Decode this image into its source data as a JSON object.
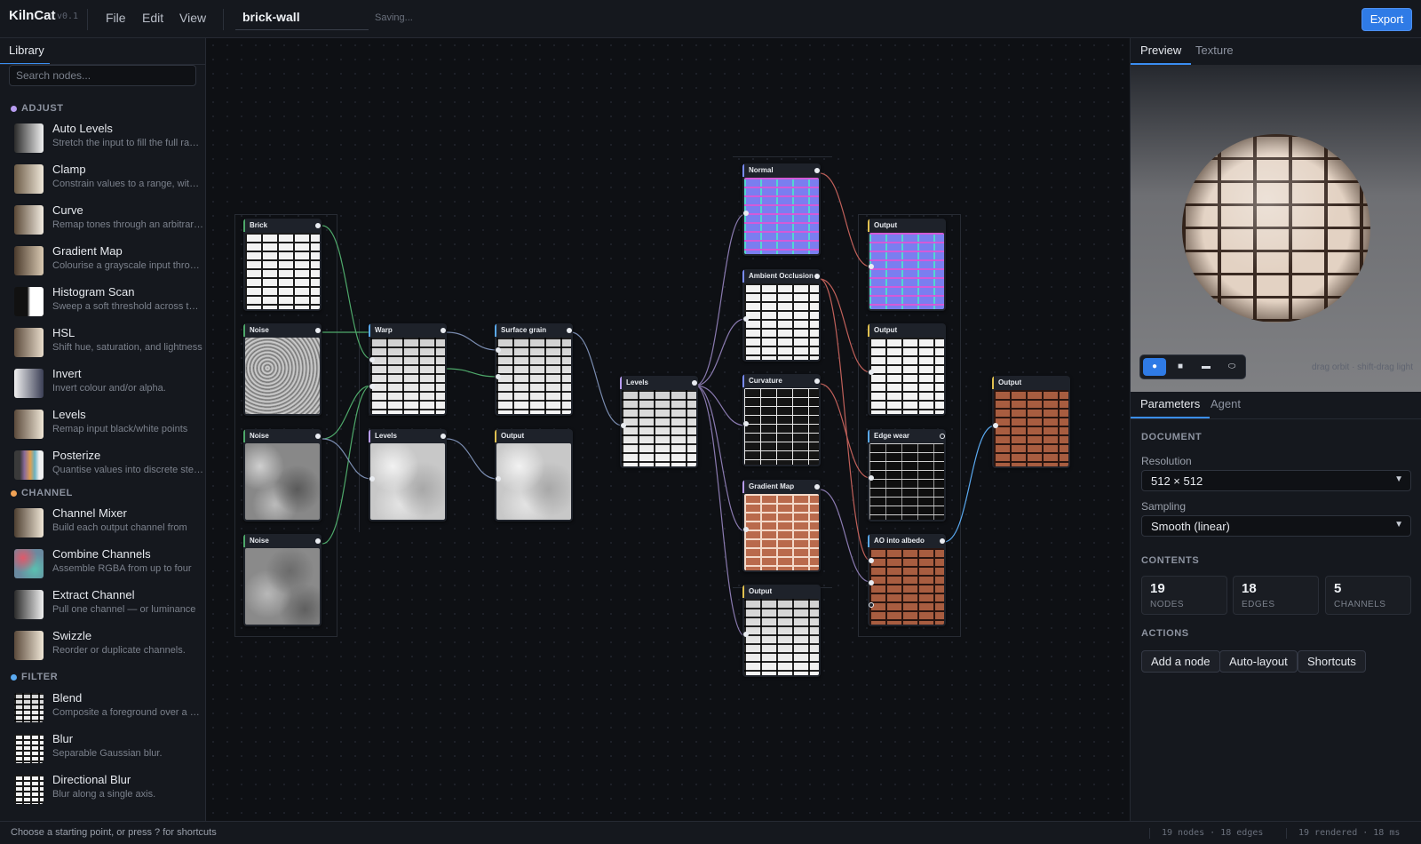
{
  "app": {
    "name": "KilnCat",
    "version": "v0.1"
  },
  "menu": [
    "File",
    "Edit",
    "View"
  ],
  "document": {
    "name": "brick-wall",
    "status": "Saving..."
  },
  "export_label": "Export",
  "library": {
    "tab": "Library",
    "search_placeholder": "Search nodes...",
    "categories": [
      {
        "name": "ADJUST",
        "color": "#b79cf0",
        "items": [
          {
            "name": "Auto Levels",
            "desc": "Stretch the input to fill the full range"
          },
          {
            "name": "Clamp",
            "desc": "Constrain values to a range, without"
          },
          {
            "name": "Curve",
            "desc": "Remap tones through an arbitrary curve"
          },
          {
            "name": "Gradient Map",
            "desc": "Colourise a grayscale input through"
          },
          {
            "name": "Histogram Scan",
            "desc": "Sweep a soft threshold across the input"
          },
          {
            "name": "HSL",
            "desc": "Shift hue, saturation, and lightness"
          },
          {
            "name": "Invert",
            "desc": "Invert colour and/or alpha."
          },
          {
            "name": "Levels",
            "desc": "Remap input black/white points"
          },
          {
            "name": "Posterize",
            "desc": "Quantise values into discrete steps"
          }
        ]
      },
      {
        "name": "CHANNEL",
        "color": "#f0a255",
        "items": [
          {
            "name": "Channel Mixer",
            "desc": "Build each output channel from"
          },
          {
            "name": "Combine Channels",
            "desc": "Assemble RGBA from up to four"
          },
          {
            "name": "Extract Channel",
            "desc": "Pull one channel — or luminance"
          },
          {
            "name": "Swizzle",
            "desc": "Reorder or duplicate channels."
          }
        ]
      },
      {
        "name": "FILTER",
        "color": "#5aa9f0",
        "items": [
          {
            "name": "Blend",
            "desc": "Composite a foreground over a background"
          },
          {
            "name": "Blur",
            "desc": "Separable Gaussian blur."
          },
          {
            "name": "Directional Blur",
            "desc": "Blur along a single axis."
          }
        ]
      }
    ]
  },
  "graph": {
    "nodes": [
      "Brick",
      "Noise",
      "Noise",
      "Noise",
      "Warp",
      "Levels",
      "Surface grain",
      "Output",
      "Levels",
      "Normal",
      "Ambient Occlusion",
      "Curvature",
      "Gradient Map",
      "Output",
      "Output",
      "Output",
      "Edge wear",
      "AO into albedo",
      "Output"
    ]
  },
  "right": {
    "tabs": [
      "Preview",
      "Texture"
    ],
    "shape_buttons": [
      "sphere",
      "cube",
      "plane",
      "cylinder"
    ],
    "hint": "drag orbit · shift-drag light",
    "panel_tabs": [
      "Parameters",
      "Agent"
    ],
    "document_section": "DOCUMENT",
    "resolution_label": "Resolution",
    "resolution_value": "512 × 512",
    "sampling_label": "Sampling",
    "sampling_value": "Smooth (linear)",
    "contents_section": "CONTENTS",
    "stats": [
      {
        "value": "19",
        "label": "NODES"
      },
      {
        "value": "18",
        "label": "EDGES"
      },
      {
        "value": "5",
        "label": "CHANNELS"
      }
    ],
    "actions_section": "ACTIONS",
    "actions": [
      "Add a node",
      "Auto-layout",
      "Shortcuts"
    ]
  },
  "status": {
    "hint": "Choose a starting point, or press ? for shortcuts",
    "graph": "19 nodes · 18 edges",
    "render": "19 rendered · 18 ms"
  },
  "colors": {
    "accent": "#2f7be6",
    "background": "#0f1115",
    "panel": "#15181e"
  }
}
